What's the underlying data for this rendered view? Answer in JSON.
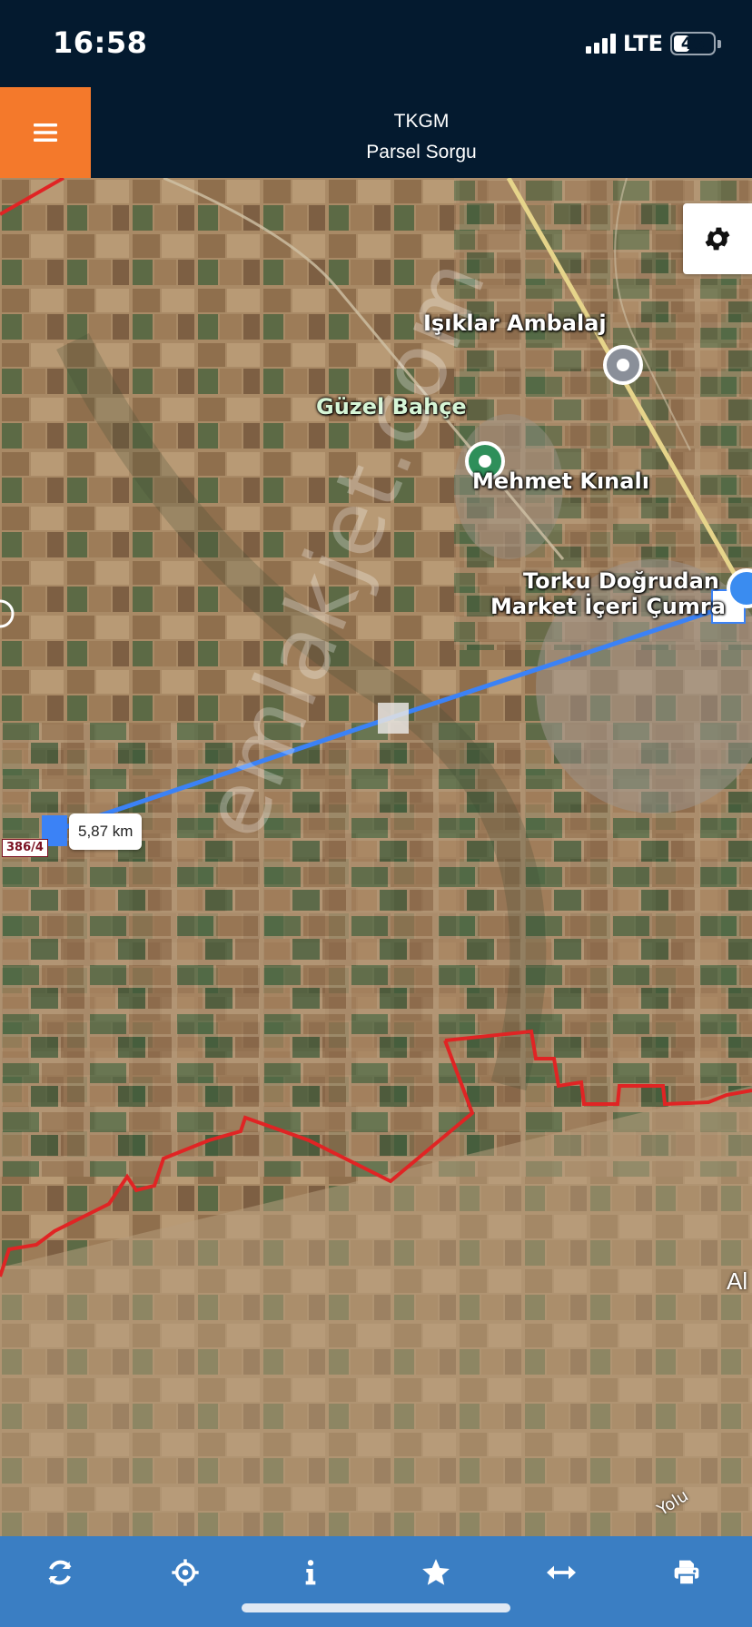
{
  "status_bar": {
    "time": "16:58",
    "network": "LTE",
    "battery": "46",
    "battery_level": 0.46
  },
  "header": {
    "title": "TKGM",
    "subtitle": "Parsel Sorgu"
  },
  "map": {
    "places": {
      "isiklar": "Işıklar Ambalaj",
      "guzel": "Güzel Bahçe",
      "mehmet": "Mehmet Kınalı",
      "torku_1": "Torku Doğrudan",
      "torku_2": "Market İçeri Çumra"
    },
    "distance": "5,87 km",
    "parcel": "386/4",
    "road": "Yolu",
    "edge": "Al",
    "watermark": "emlakjet.com",
    "colors": {
      "boundary": "#e02424",
      "measure_line": "#3b82f6",
      "road": "#e6d48a"
    }
  },
  "toolbar": {
    "icons": [
      "refresh-icon",
      "locate-icon",
      "info-icon",
      "favorite-icon",
      "measure-icon",
      "print-icon"
    ]
  },
  "colors": {
    "header_bg": "#041a2f",
    "menu_accent": "#f4792b",
    "toolbar_bg": "#3a7ec3"
  }
}
